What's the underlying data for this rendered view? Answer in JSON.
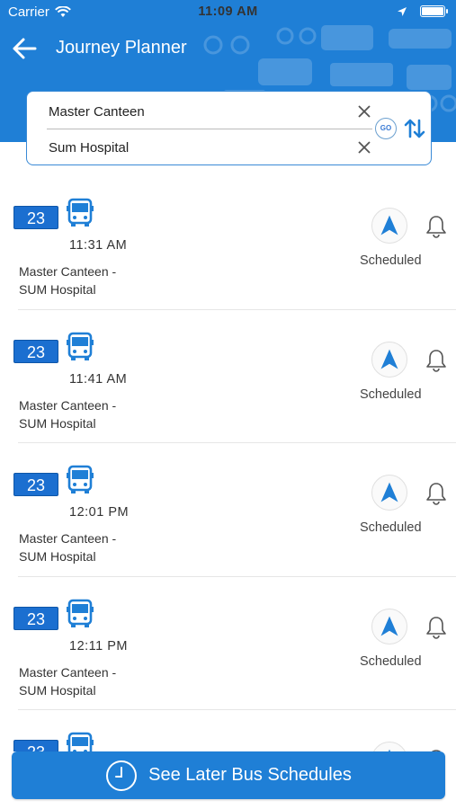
{
  "status_bar": {
    "carrier": "Carrier",
    "time": "11:09 AM"
  },
  "header": {
    "title": "Journey Planner",
    "accent_color": "#1f7fd6"
  },
  "search": {
    "from_value": "Master Canteen",
    "to_value": "Sum Hospital",
    "go_label": "GO"
  },
  "results": [
    {
      "route": "23",
      "time": "11:31  AM",
      "route_line1": "Master Canteen -",
      "route_line2": "SUM Hospital",
      "status": "Scheduled"
    },
    {
      "route": "23",
      "time": "11:41  AM",
      "route_line1": "Master Canteen -",
      "route_line2": "SUM Hospital",
      "status": "Scheduled"
    },
    {
      "route": "23",
      "time": "12:01  PM",
      "route_line1": "Master Canteen -",
      "route_line2": "SUM Hospital",
      "status": "Scheduled"
    },
    {
      "route": "23",
      "time": "12:11  PM",
      "route_line1": "Master Canteen -",
      "route_line2": "SUM Hospital",
      "status": "Scheduled"
    },
    {
      "route": "23",
      "time": "",
      "route_line1": "",
      "route_line2": "",
      "status": ""
    }
  ],
  "bottom_button": {
    "label": "See Later Bus Schedules"
  }
}
